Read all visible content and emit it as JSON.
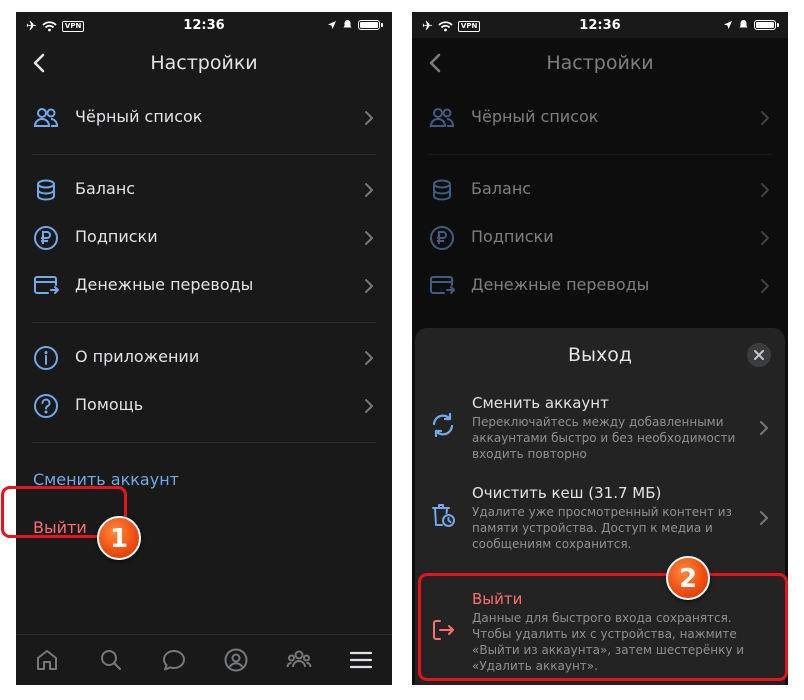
{
  "status": {
    "time": "12:36",
    "vpn": "VPN"
  },
  "screen1": {
    "title": "Настройки",
    "items": [
      {
        "label": "Чёрный список",
        "icon": "users-icon"
      },
      {
        "label": "Баланс",
        "icon": "coins-icon"
      },
      {
        "label": "Подписки",
        "icon": "ruble-icon"
      },
      {
        "label": "Денежные переводы",
        "icon": "card-transfer-icon"
      },
      {
        "label": "О приложении",
        "icon": "info-icon"
      },
      {
        "label": "Помощь",
        "icon": "help-icon"
      }
    ],
    "switch_account": "Сменить аккаунт",
    "logout": "Выйти",
    "step": "1",
    "tabs": [
      "home-icon",
      "search-icon",
      "messages-icon",
      "profile-icon",
      "friends-icon",
      "menu-icon"
    ]
  },
  "screen2": {
    "title": "Настройки",
    "items": [
      {
        "label": "Чёрный список"
      },
      {
        "label": "Баланс"
      },
      {
        "label": "Подписки"
      },
      {
        "label": "Денежные переводы"
      }
    ],
    "sheet": {
      "title": "Выход",
      "options": [
        {
          "title": "Сменить аккаунт",
          "desc": "Переключайтесь между добавленными аккаунтами быстро и без необходимости входить повторно",
          "icon": "refresh-icon"
        },
        {
          "title": "Очистить кеш (31.7 МБ)",
          "desc": "Удалите уже просмотренный контент из памяти устройства. Доступ к медиа и сообщениям сохранится.",
          "icon": "clear-cache-icon"
        },
        {
          "title": "Выйти",
          "desc": "Данные для быстрого входа сохранятся. Чтобы удалить их с устройства, нажмите «Выйти из аккаунта», затем шестерёнку и «Удалить аккаунт».",
          "icon": "logout-icon"
        }
      ]
    },
    "step": "2"
  },
  "colors": {
    "background": "#19191a",
    "accent": "#71aaeb",
    "danger": "#ff6f6f",
    "highlight": "#e8131a",
    "badge": "#ef4f12"
  }
}
